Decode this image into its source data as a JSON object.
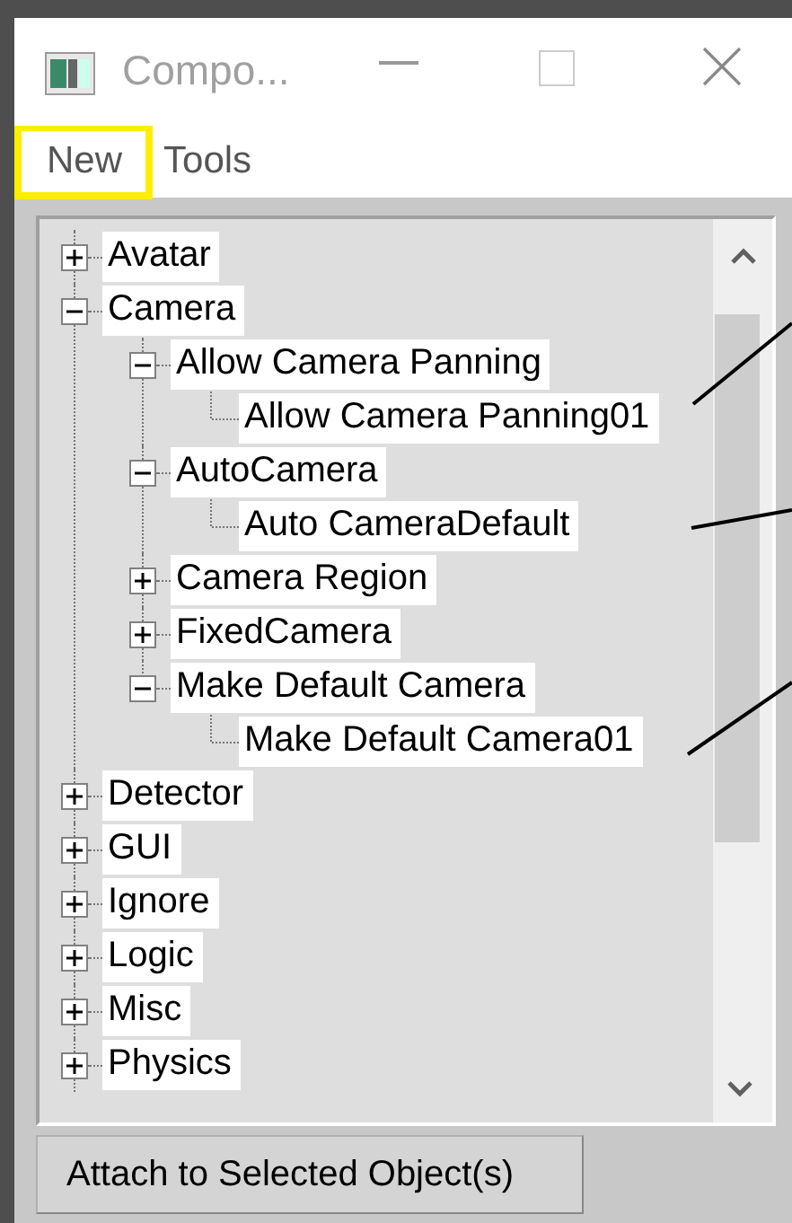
{
  "window": {
    "title": "Compo..."
  },
  "menu": [
    {
      "label": "New",
      "highlighted": true
    },
    {
      "label": "Tools",
      "highlighted": false
    }
  ],
  "tree": [
    {
      "label": "Avatar",
      "expanded": false
    },
    {
      "label": "Camera",
      "expanded": true,
      "children": [
        {
          "label": "Allow Camera Panning",
          "expanded": true,
          "children": [
            {
              "label": "Allow Camera Panning01"
            }
          ]
        },
        {
          "label": "AutoCamera",
          "expanded": true,
          "children": [
            {
              "label": "Auto CameraDefault"
            }
          ]
        },
        {
          "label": "Camera Region",
          "expanded": false
        },
        {
          "label": "FixedCamera",
          "expanded": false
        },
        {
          "label": "Make Default Camera",
          "expanded": true,
          "children": [
            {
              "label": "Make Default Camera01"
            }
          ]
        }
      ]
    },
    {
      "label": "Detector",
      "expanded": false
    },
    {
      "label": "GUI",
      "expanded": false
    },
    {
      "label": "Ignore",
      "expanded": false
    },
    {
      "label": "Logic",
      "expanded": false
    },
    {
      "label": "Misc",
      "expanded": false
    },
    {
      "label": "Physics",
      "expanded": false
    }
  ],
  "buttons": [
    "Attach to Selected Object(s)"
  ]
}
